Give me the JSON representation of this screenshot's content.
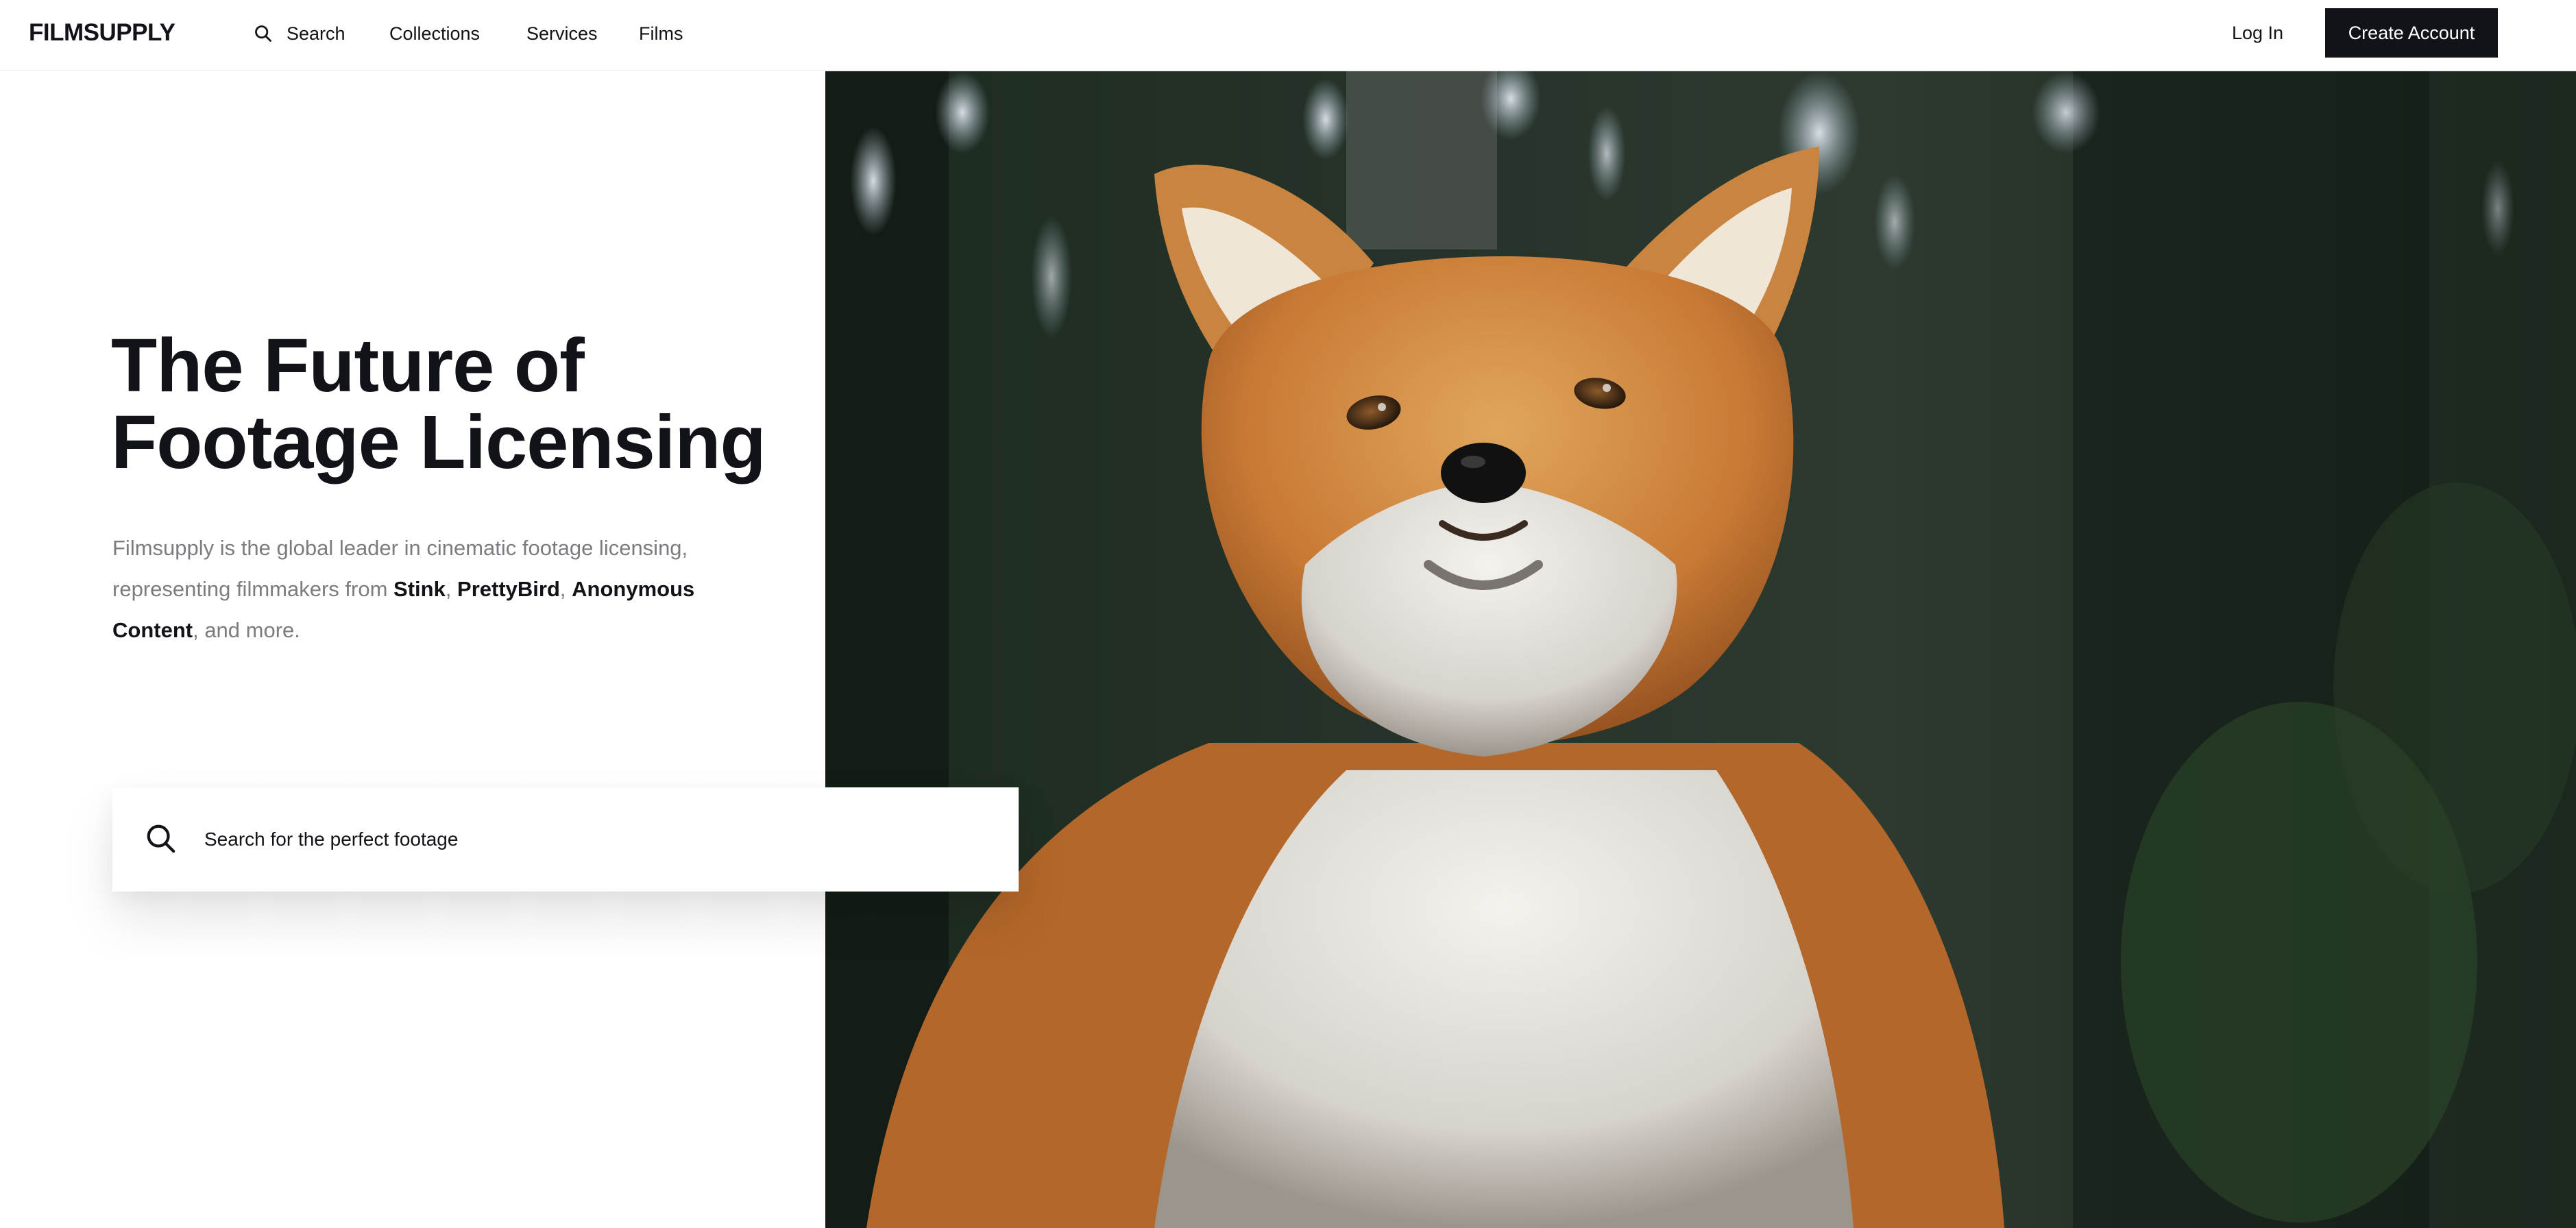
{
  "header": {
    "logo": "FILMSUPPLY",
    "nav": {
      "search": "Search",
      "collections": "Collections",
      "services": "Services",
      "films": "Films"
    },
    "login": "Log In",
    "create_account": "Create Account"
  },
  "hero": {
    "headline_line1": "The Future of",
    "headline_line2": "Footage Licensing",
    "intro": {
      "part1": "Filmsupply is the global leader in cinematic footage licensing, representing filmmakers from ",
      "brand1": "Stink",
      "sep1": ", ",
      "brand2": "PrettyBird",
      "sep2": ", ",
      "brand3": "Anonymous Content",
      "part2": ", and more."
    },
    "search_placeholder": "Search for the perfect footage"
  },
  "colors": {
    "brand_dark": "#121318",
    "body_gray": "#7a7c80",
    "background": "#ffffff"
  },
  "icons": {
    "nav_search": "search-icon",
    "hero_search": "search-icon"
  }
}
